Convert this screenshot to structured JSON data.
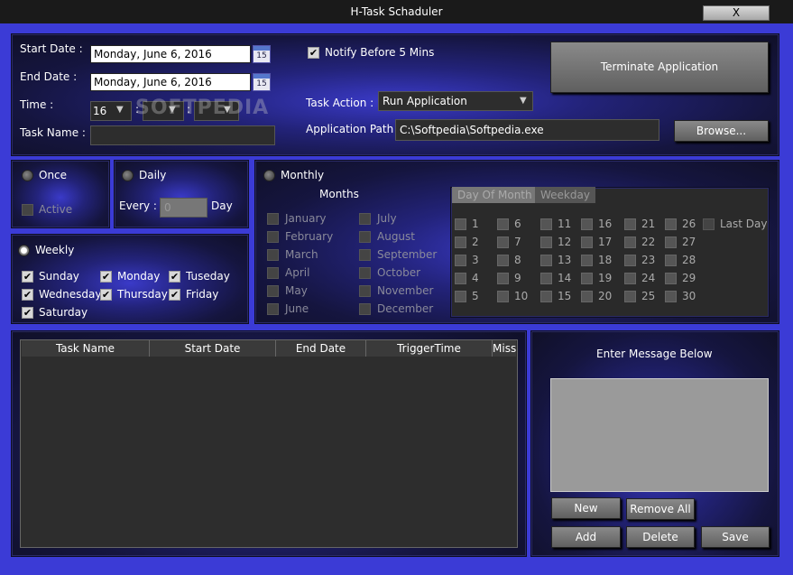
{
  "window": {
    "title": "H-Task Schaduler",
    "close_label": "X"
  },
  "schedule": {
    "start_date_label": "Start Date :",
    "start_date_value": "Monday, June 6, 2016",
    "end_date_label": "End Date :",
    "end_date_value": "Monday, June 6, 2016",
    "calendar_icon_text": "15",
    "time_label": "Time :",
    "time_hour": "16",
    "time_sep": ":",
    "task_name_label": "Task Name :",
    "task_name_value": ""
  },
  "options": {
    "notify_label": "Notify Before 5 Mins",
    "notify_checked": true,
    "task_action_label": "Task Action :",
    "task_action_value": "Run Application",
    "app_path_label": "Application Path :",
    "app_path_value": "C:\\Softpedia\\Softpedia.exe",
    "browse_label": "Browse...",
    "terminate_label": "Terminate Application"
  },
  "watermark": "SOFTPEDIA",
  "once": {
    "label": "Once",
    "active_label": "Active"
  },
  "daily": {
    "label": "Daily",
    "every_label": "Every :",
    "every_value": "0",
    "day_label": "Day"
  },
  "weekly": {
    "label": "Weekly",
    "days": [
      {
        "label": "Sunday",
        "checked": true
      },
      {
        "label": "Monday",
        "checked": true
      },
      {
        "label": "Tuseday",
        "checked": true
      },
      {
        "label": "Wednesday",
        "checked": true
      },
      {
        "label": "Thursday",
        "checked": true
      },
      {
        "label": "Friday",
        "checked": true
      },
      {
        "label": "Saturday",
        "checked": true
      }
    ]
  },
  "monthly": {
    "label": "Monthly",
    "months_title": "Months",
    "months": [
      "January",
      "February",
      "March",
      "April",
      "May",
      "June",
      "July",
      "August",
      "September",
      "October",
      "November",
      "December"
    ],
    "tabs": [
      "Day Of Month",
      "Weekday"
    ],
    "days": [
      "1",
      "2",
      "3",
      "4",
      "5",
      "6",
      "7",
      "8",
      "9",
      "10",
      "11",
      "12",
      "13",
      "14",
      "15",
      "16",
      "17",
      "18",
      "19",
      "20",
      "21",
      "22",
      "23",
      "24",
      "25",
      "26",
      "27",
      "28",
      "29",
      "30"
    ],
    "last_day_label": "Last Day"
  },
  "task_grid": {
    "columns": [
      "Task Name",
      "Start Date",
      "End Date",
      "TriggerTime",
      "Miss"
    ]
  },
  "message": {
    "title": "Enter Message Below",
    "value": "",
    "new_label": "New",
    "remove_all_label": "Remove All",
    "add_label": "Add",
    "delete_label": "Delete",
    "save_label": "Save"
  }
}
